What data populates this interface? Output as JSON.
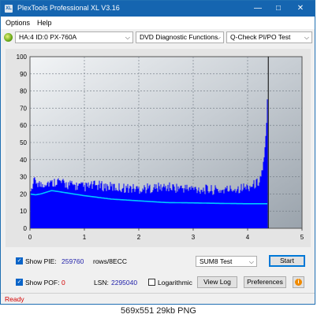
{
  "window": {
    "title": "PlexTools Professional XL V3.16",
    "icon_label": "XL",
    "controls": {
      "minimize": "—",
      "maximize": "□",
      "close": "✕"
    }
  },
  "menu": {
    "items": [
      "Options",
      "Help"
    ]
  },
  "toolbar": {
    "drive": "HA:4 ID:0  PX-760A",
    "function": "DVD Diagnostic Functions",
    "test": "Q-Check PI/PO Test",
    "drive_icon": "disc-drive-icon"
  },
  "chart_data": {
    "type": "bar",
    "xlim": [
      0,
      5
    ],
    "ylim": [
      0,
      100
    ],
    "x_ticks": [
      "0",
      "1",
      "2",
      "3",
      "4",
      "5"
    ],
    "y_ticks": [
      "0",
      "10",
      "20",
      "30",
      "40",
      "50",
      "60",
      "70",
      "80",
      "90",
      "100"
    ],
    "grid": true,
    "end_position": 4.38,
    "series": [
      {
        "color": "#0000ff",
        "values_at_x": [
          0,
          0.1,
          0.2,
          0.3,
          0.4,
          0.5,
          0.6,
          0.8,
          1.0,
          1.2,
          1.5,
          2.0,
          2.5,
          3.0,
          3.5,
          4.0,
          4.1,
          4.2,
          4.25,
          4.3,
          4.33,
          4.36,
          4.38
        ],
        "values": [
          21,
          27,
          24,
          26,
          25,
          27,
          25,
          24,
          23,
          24,
          23,
          22,
          23,
          22,
          21,
          23,
          24,
          26,
          30,
          38,
          48,
          70,
          92
        ]
      },
      {
        "color": "#00c8ff",
        "values_at_x": [
          0,
          0.1,
          0.2,
          0.3,
          0.4,
          0.5,
          0.7,
          1.0,
          1.5,
          2.0,
          2.5,
          3.0,
          3.5,
          4.0,
          4.38
        ],
        "values": [
          20,
          19.5,
          20,
          21,
          22,
          21.5,
          20.5,
          19,
          17,
          16,
          15,
          14.8,
          14.5,
          14.3,
          14.3
        ]
      }
    ]
  },
  "bottom": {
    "show_pie_label": "Show PIE:",
    "pie_value": "259760",
    "pie_unit": "rows/8ECC",
    "test_type": "SUM8 Test",
    "start_label": "Start",
    "show_pof_label": "Show POF:",
    "pof_value": "0",
    "lsn_label": "LSN:",
    "lsn_value": "2295040",
    "logarithmic_label": "Logarithmic",
    "view_log_label": "View Log",
    "preferences_label": "Preferences",
    "info_icon": "info-icon",
    "colors": {
      "pie_value": "#2222aa",
      "pof_value": "#d40000"
    }
  },
  "status": {
    "text": "Ready",
    "color": "#d40000"
  },
  "caption": "569x551 29kb PNG"
}
